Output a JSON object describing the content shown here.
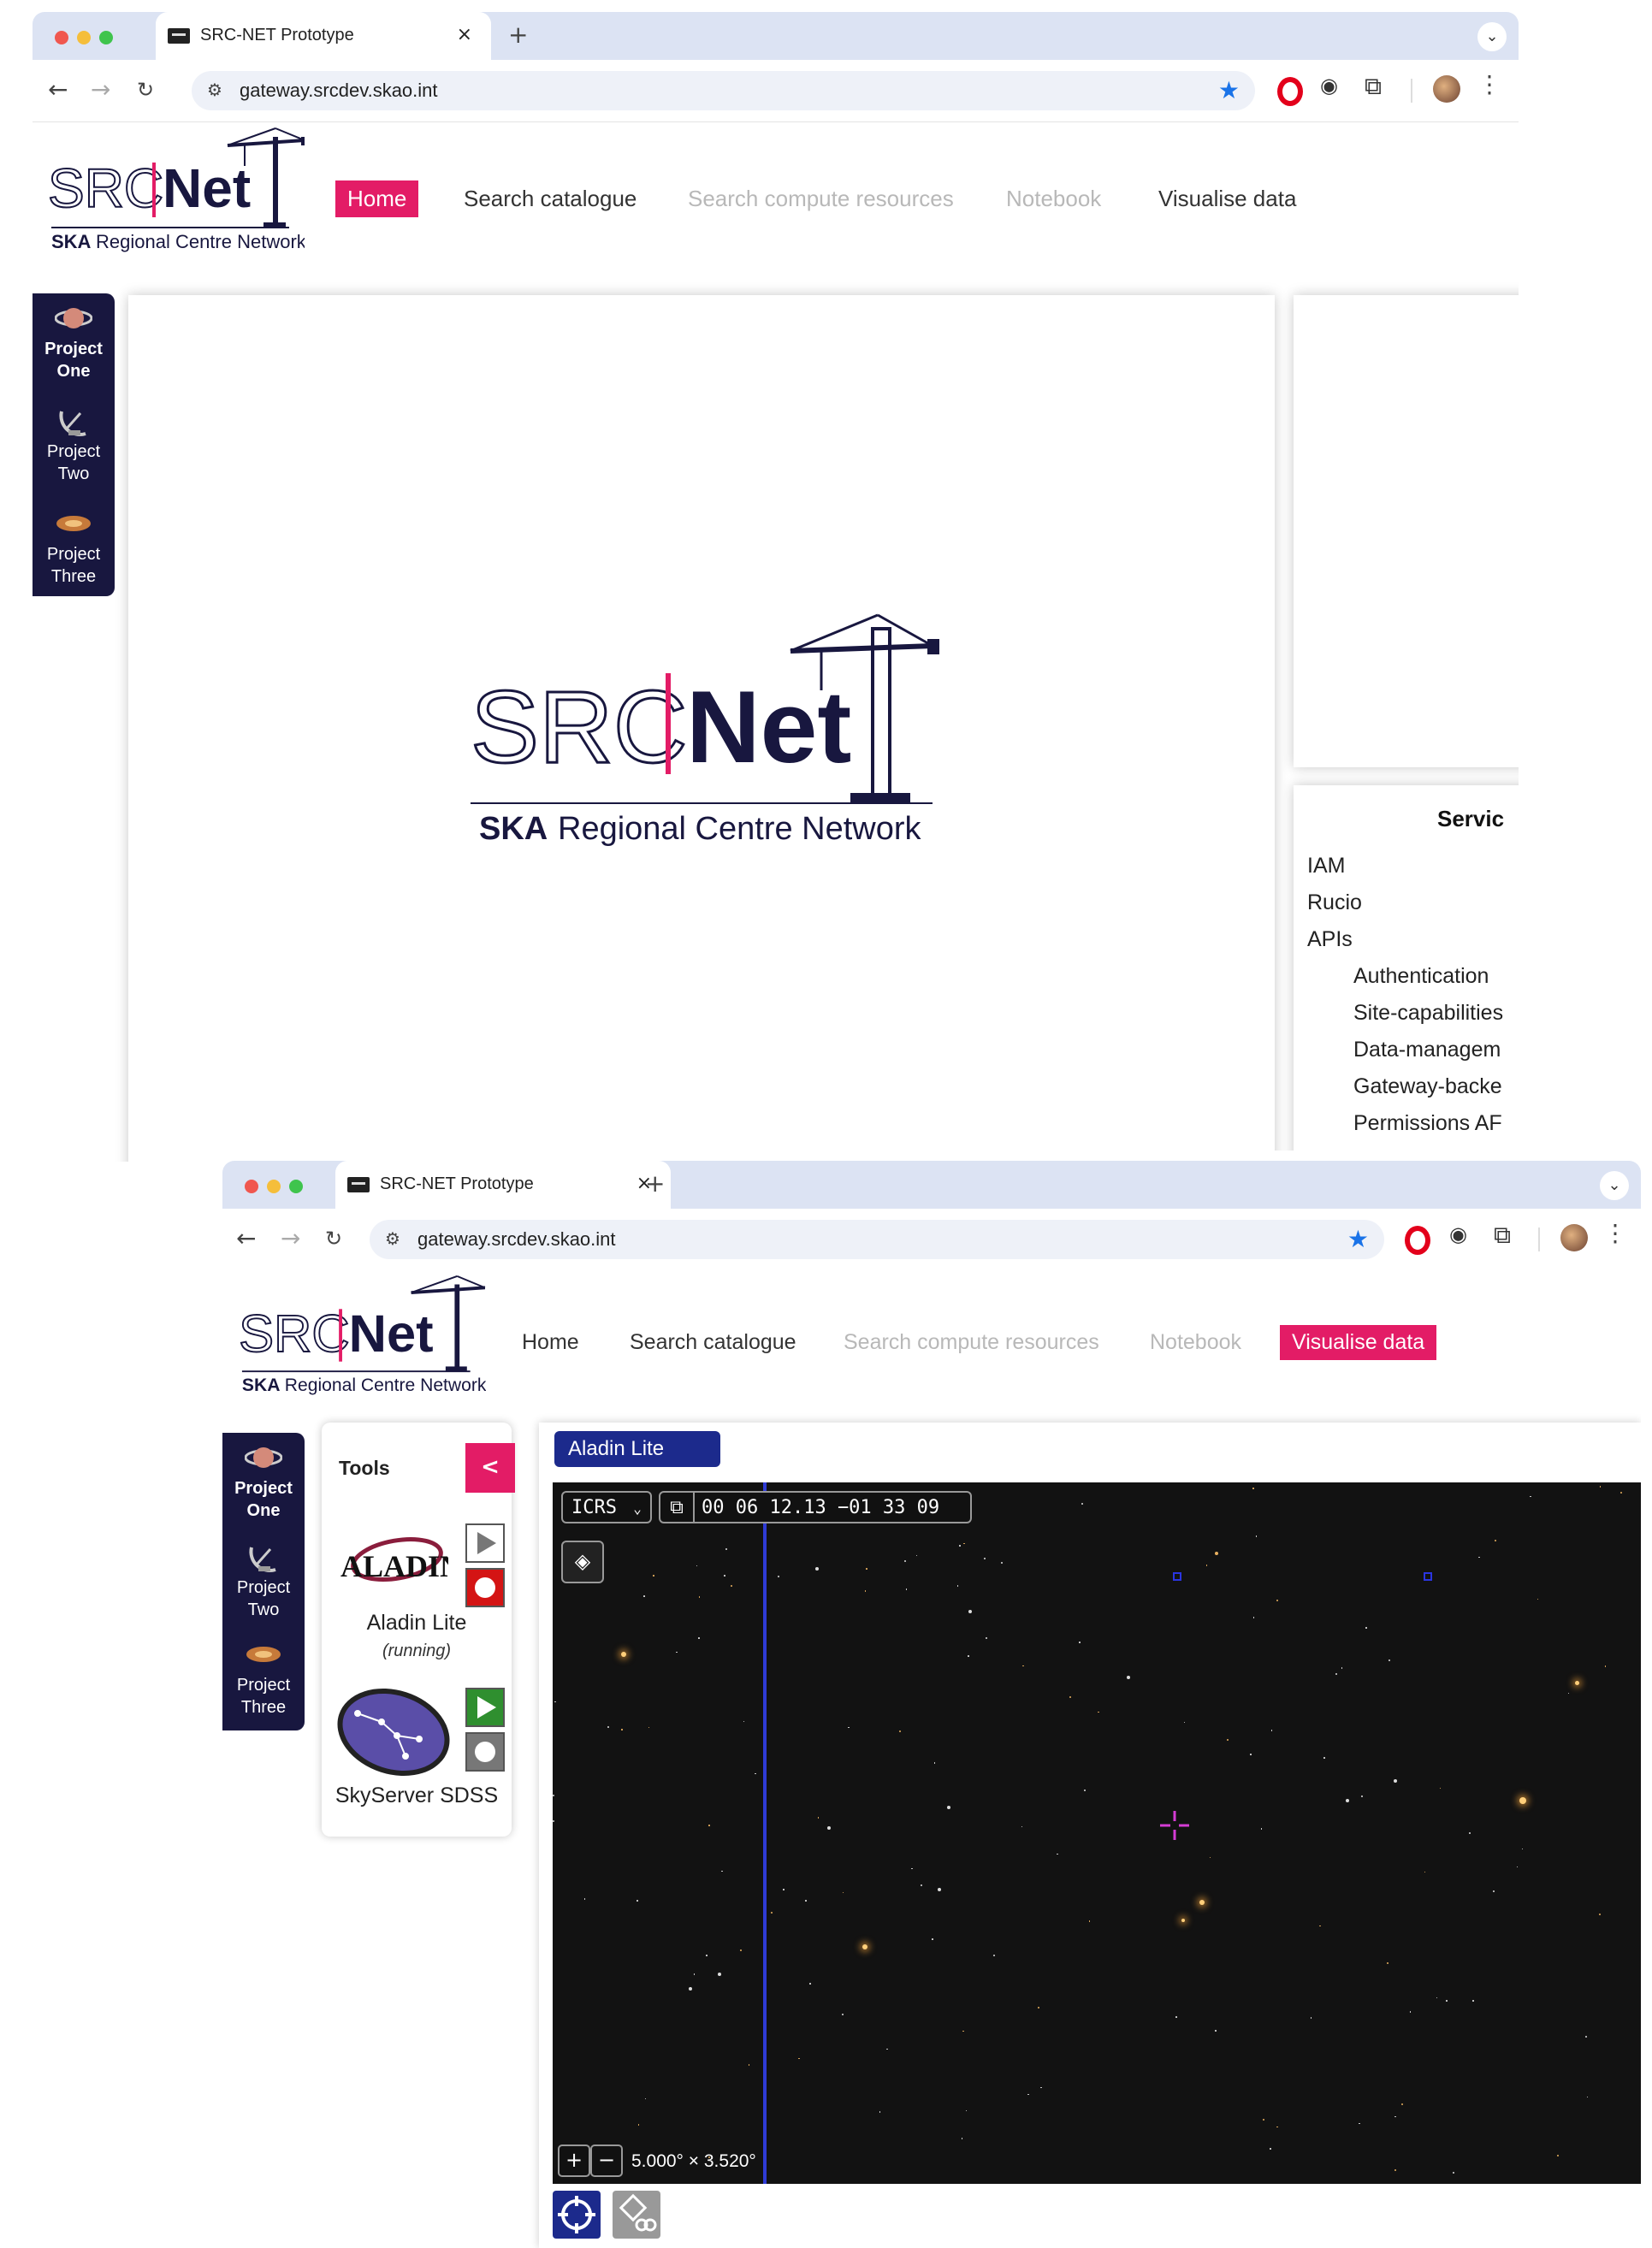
{
  "browser": {
    "tab_title": "SRC-NET Prototype",
    "tab_close": "×",
    "new_tab": "+",
    "url": "gateway.srcdev.skao.int"
  },
  "logo": {
    "src": "SRC",
    "net": "Net",
    "ska": "SKA",
    "subtitle": "Regional Centre Network"
  },
  "nav": [
    {
      "label": "Home",
      "state": "enabled"
    },
    {
      "label": "Search catalogue",
      "state": "enabled"
    },
    {
      "label": "Search compute resources",
      "state": "disabled"
    },
    {
      "label": "Notebook",
      "state": "disabled"
    },
    {
      "label": "Visualise data",
      "state": "enabled"
    }
  ],
  "projects": [
    {
      "line1": "Project",
      "line2": "One",
      "icon": "planet-icon"
    },
    {
      "line1": "Project",
      "line2": "Two",
      "icon": "satellite-dish-icon"
    },
    {
      "line1": "Project",
      "line2": "Three",
      "icon": "galaxy-icon"
    }
  ],
  "home": {
    "active_nav": "Home",
    "services_title": "Servic",
    "services": [
      "IAM",
      "Rucio",
      "APIs"
    ],
    "apis": [
      "Authentication",
      "Site-capabilities",
      "Data-managem",
      "Gateway-backe",
      "Permissions AF"
    ]
  },
  "visualise": {
    "active_nav": "Visualise data",
    "tools_title": "Tools",
    "collapse_label": "<",
    "tools": [
      {
        "name": "Aladin Lite",
        "status": "(running)",
        "logo_text": "ALADIN"
      },
      {
        "name": "SkyServer SDSS",
        "status": "",
        "logo_text": ""
      }
    ],
    "viewer_tab": "Aladin Lite",
    "frame": "ICRS",
    "coordinates": "00 06 12.13 −01 33 09",
    "zoom_in": "+",
    "zoom_out": "−",
    "fov": "5.000° × 3.520°"
  },
  "colors": {
    "brand_pink": "#e31c66",
    "brand_navy": "#18173f",
    "aladin_blue": "#1c2a8c",
    "disabled_text": "#b8b8b8"
  }
}
